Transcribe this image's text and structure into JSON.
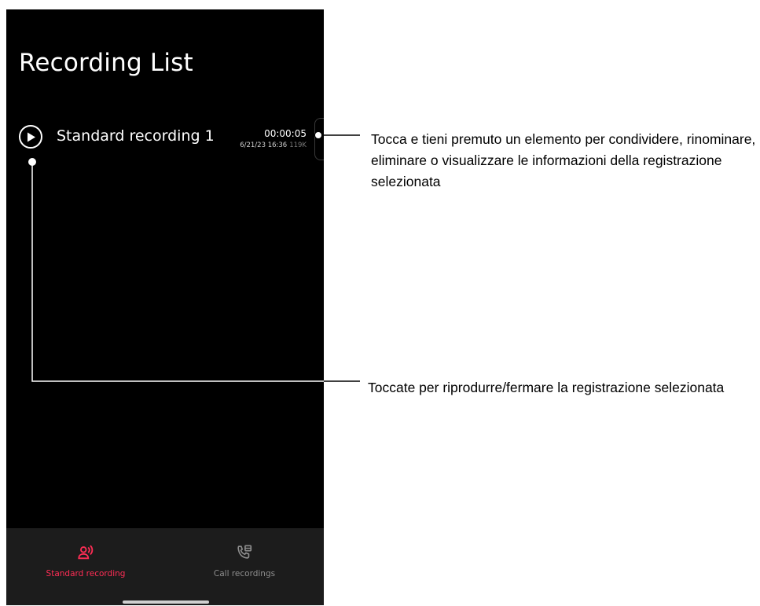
{
  "page": {
    "title": "Recording List"
  },
  "recordings": [
    {
      "name": "Standard recording 1",
      "duration": "00:00:05",
      "datetime": "6/21/23 16:36",
      "size": "119K"
    }
  ],
  "bottom_nav": {
    "tabs": [
      {
        "label": "Standard recording",
        "icon": "microphone-person-icon",
        "active": true
      },
      {
        "label": "Call recordings",
        "icon": "phone-recording-icon",
        "active": false
      }
    ]
  },
  "annotations": {
    "long_press": "Tocca e tieni premuto un elemento per condividere, rinominare, eliminare o visualizzare le informazioni della registrazione selezionata",
    "play_stop": "Toccate per riprodurre/fermare la registrazione selezionata"
  },
  "colors": {
    "accent": "#ff2d55",
    "screen_background": "#000000",
    "nav_background": "#1c1c1c",
    "inactive": "#8e8e8e"
  }
}
